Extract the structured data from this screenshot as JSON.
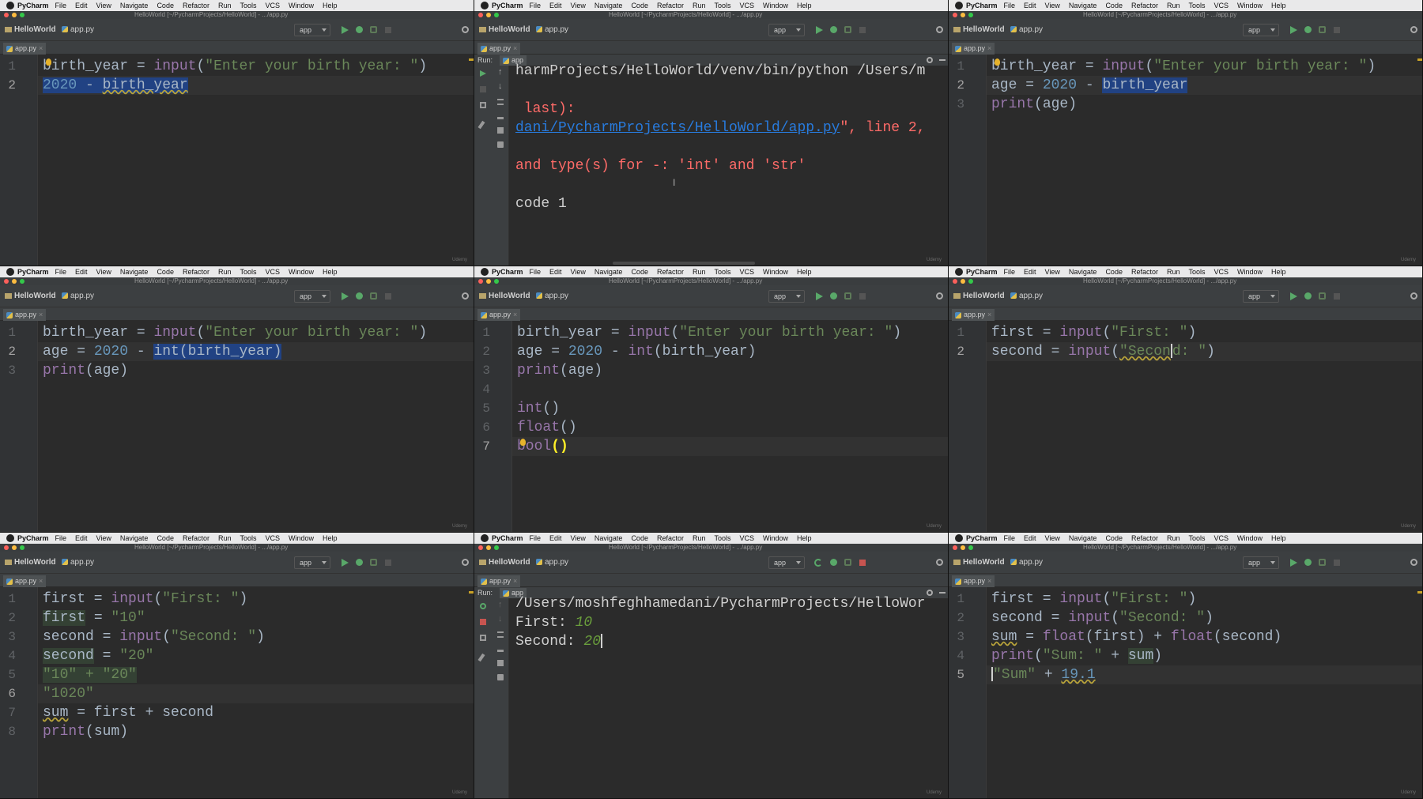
{
  "menu": {
    "app": "PyCharm",
    "items": [
      "File",
      "Edit",
      "View",
      "Navigate",
      "Code",
      "Refactor",
      "Run",
      "Tools",
      "VCS",
      "Window",
      "Help"
    ]
  },
  "window_title": "HelloWorld [~/PycharmProjects/HelloWorld] - .../app.py",
  "breadcrumb": {
    "project": "HelloWorld",
    "file": "app.py"
  },
  "run_config": "app",
  "tab_label": "app.py",
  "run_label": "Run:",
  "run_tab": "app",
  "watermark": "Udemy",
  "colors": {
    "background": "#2b2b2b",
    "keyword": "#9876aa",
    "string": "#6a8759",
    "number": "#6897bb",
    "selection": "#214283",
    "error": "#ff6b68",
    "link": "#287bde",
    "input": "#6a9e3c"
  },
  "panels": [
    {
      "lines": [
        "1",
        "2"
      ],
      "code": {
        "l1": {
          "a": "birth_year = ",
          "b": "input",
          "c": "(",
          "d": "\"Enter your birth year: \"",
          "e": ")"
        },
        "l2": {
          "num": "2020",
          "rest": " - ",
          "sel": "birth_year"
        }
      }
    },
    {
      "output": {
        "o1": "harmProjects/HelloWorld/venv/bin/python /Users/m",
        "o2": " last):",
        "o3_link": "dani/PycharmProjects/HelloWorld/app.py",
        "o3_rest": "\", line 2,",
        "o4": "and type(s) for -: 'int' and 'str'",
        "o5": "code 1"
      }
    },
    {
      "lines": [
        "1",
        "2",
        "3"
      ],
      "code": {
        "l1": {
          "a": "birth_year = ",
          "b": "input",
          "c": "(",
          "d": "\"Enter your birth year: \"",
          "e": ")"
        },
        "l2": {
          "a": "age = ",
          "num": "2020",
          "b": " - ",
          "sel": "birth_year"
        },
        "l3": {
          "a": "print",
          "b": "(age)"
        }
      }
    },
    {
      "lines": [
        "1",
        "2",
        "3"
      ],
      "code": {
        "l1": {
          "a": "birth_year = ",
          "b": "input",
          "c": "(",
          "d": "\"Enter your birth year: \"",
          "e": ")"
        },
        "l2": {
          "a": "age = ",
          "num": "2020",
          "b": " - ",
          "sel": "int(birth_year)"
        },
        "l3": {
          "a": "print",
          "b": "(age)"
        }
      }
    },
    {
      "lines": [
        "1",
        "2",
        "3",
        "4",
        "5",
        "6",
        "7"
      ],
      "code": {
        "l1": {
          "a": "birth_year = ",
          "b": "input",
          "c": "(",
          "d": "\"Enter your birth year: \"",
          "e": ")"
        },
        "l2": {
          "a": "age = ",
          "num": "2020",
          "b": " - ",
          "c": "int",
          "d": "(birth_year)"
        },
        "l3": {
          "a": "print",
          "b": "(age)"
        },
        "l5": {
          "a": "int",
          "b": "()"
        },
        "l6": {
          "a": "float",
          "b": "()"
        },
        "l7": {
          "a": "bool",
          "b": "()"
        }
      }
    },
    {
      "lines": [
        "1",
        "2"
      ],
      "code": {
        "l1": {
          "a": "first = ",
          "b": "input",
          "c": "(",
          "d": "\"First: \"",
          "e": ")"
        },
        "l2": {
          "a": "second = ",
          "b": "input",
          "c": "(",
          "d": "\"Secon",
          "e": "d: \"",
          "f": ")"
        }
      }
    },
    {
      "lines": [
        "1",
        "2",
        "3",
        "4",
        "5",
        "6",
        "7",
        "8"
      ],
      "code": {
        "l1": {
          "a": "first = ",
          "b": "input",
          "c": "(",
          "d": "\"First: \"",
          "e": ")"
        },
        "l2": {
          "a": "first",
          "b": " = ",
          "c": "\"10\""
        },
        "l3": {
          "a": "second = ",
          "b": "input",
          "c": "(",
          "d": "\"Second: \"",
          "e": ")"
        },
        "l4": {
          "a": "second",
          "b": " = ",
          "c": "\"20\""
        },
        "l5": {
          "a": "\"10\" + \"20\""
        },
        "l6": {
          "a": "\"1020\""
        },
        "l7": {
          "a": "sum",
          "b": " = first + second"
        },
        "l8": {
          "a": "print",
          "b": "(sum)"
        }
      }
    },
    {
      "output": {
        "o1": "/Users/moshfeghhamedani/PycharmProjects/HelloWor",
        "o2_label": "First: ",
        "o2_val": "10",
        "o3_label": "Second: ",
        "o3_val": "20"
      }
    },
    {
      "lines": [
        "1",
        "2",
        "3",
        "4",
        "5"
      ],
      "code": {
        "l1": {
          "a": "first = ",
          "b": "input",
          "c": "(",
          "d": "\"First: \"",
          "e": ")"
        },
        "l2": {
          "a": "second = ",
          "b": "input",
          "c": "(",
          "d": "\"Second: \"",
          "e": ")"
        },
        "l3": {
          "a": "sum",
          "b": " = ",
          "c": "float",
          "d": "(first) + ",
          "e": "float",
          "f": "(second)"
        },
        "l4": {
          "a": "print",
          "b": "(",
          "c": "\"Sum: \"",
          "d": " + ",
          "e": "sum",
          "f": ")"
        },
        "l5": {
          "a": "\"Sum\"",
          "b": " + ",
          "c": "19.1"
        }
      }
    }
  ]
}
